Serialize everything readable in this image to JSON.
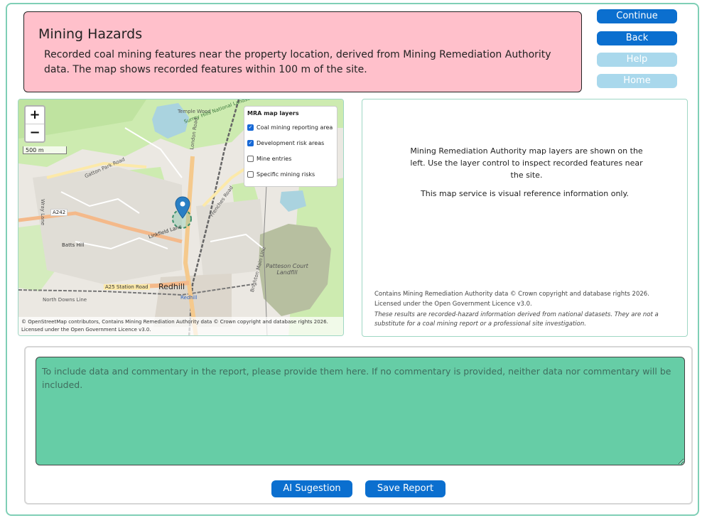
{
  "header": {
    "title": "Mining Hazards",
    "description": "Recorded coal mining features near the property location, derived from Mining Remediation Authority data. The map shows recorded features within 100 m of the site."
  },
  "nav": {
    "continue_label": "Continue",
    "back_label": "Back",
    "help_label": "Help",
    "home_label": "Home"
  },
  "map": {
    "zoom_in": "+",
    "zoom_out": "−",
    "scale_label": "500 m",
    "layers_title": "MRA map layers",
    "layers": [
      {
        "label": "Coal mining reporting area",
        "checked": true
      },
      {
        "label": "Development risk areas",
        "checked": true
      },
      {
        "label": "Mine entries",
        "checked": false
      },
      {
        "label": "Specific mining risks",
        "checked": false
      }
    ],
    "place_labels": {
      "redhill": "Redhill",
      "redhill_station": "Redhill",
      "patteson": "Patteson Court Landfill",
      "a242": "A242",
      "a25": "A25 Station Road",
      "batts_hill": "Batts Hill",
      "linkfield": "Linkfield Lane",
      "london_road": "London Road",
      "frenches": "Frenches Road",
      "gatton": "Gatton Park Road",
      "surrey_hills": "Surrey Hills National Landscape",
      "north_downs": "North Downs Line",
      "temple": "Temple Wood",
      "wray": "Wray Lane",
      "brighton": "Brighton Main Line"
    },
    "attribution": "© OpenStreetMap contributors, Contains Mining Remediation Authority data © Crown copyright and database rights 2026. Licensed under the Open Government Licence v3.0.",
    "colors": {
      "marker": "#2a7fc4",
      "water": "#aad3df",
      "park": "#cdebb0",
      "landfill": "#b5c0a0"
    }
  },
  "info": {
    "description": "Mining Remediation Authority map layers are shown on the left. Use the layer control to inspect recorded features near the site.",
    "note": "This map service is visual reference information only.",
    "credit": "Contains Mining Remediation Authority data © Crown copyright and database rights 2026. Licensed under the Open Government Licence v3.0.",
    "disclaimer": "These results are recorded-hazard information derived from national datasets. They are not a substitute for a coal mining report or a professional site investigation."
  },
  "commentary": {
    "placeholder": "To include data and commentary in the report, please provide them here. If no commentary is provided, neither data nor commentary will be included.",
    "value": ""
  },
  "actions": {
    "ai_label": "AI Sugestion",
    "save_label": "Save Report"
  },
  "colors": {
    "accent": "#0b6fcf",
    "inactive": "#a9d8ec",
    "header_bg": "#ffc0cb",
    "textarea_bg": "#66cda6",
    "frame_border": "#7fcfb6"
  }
}
